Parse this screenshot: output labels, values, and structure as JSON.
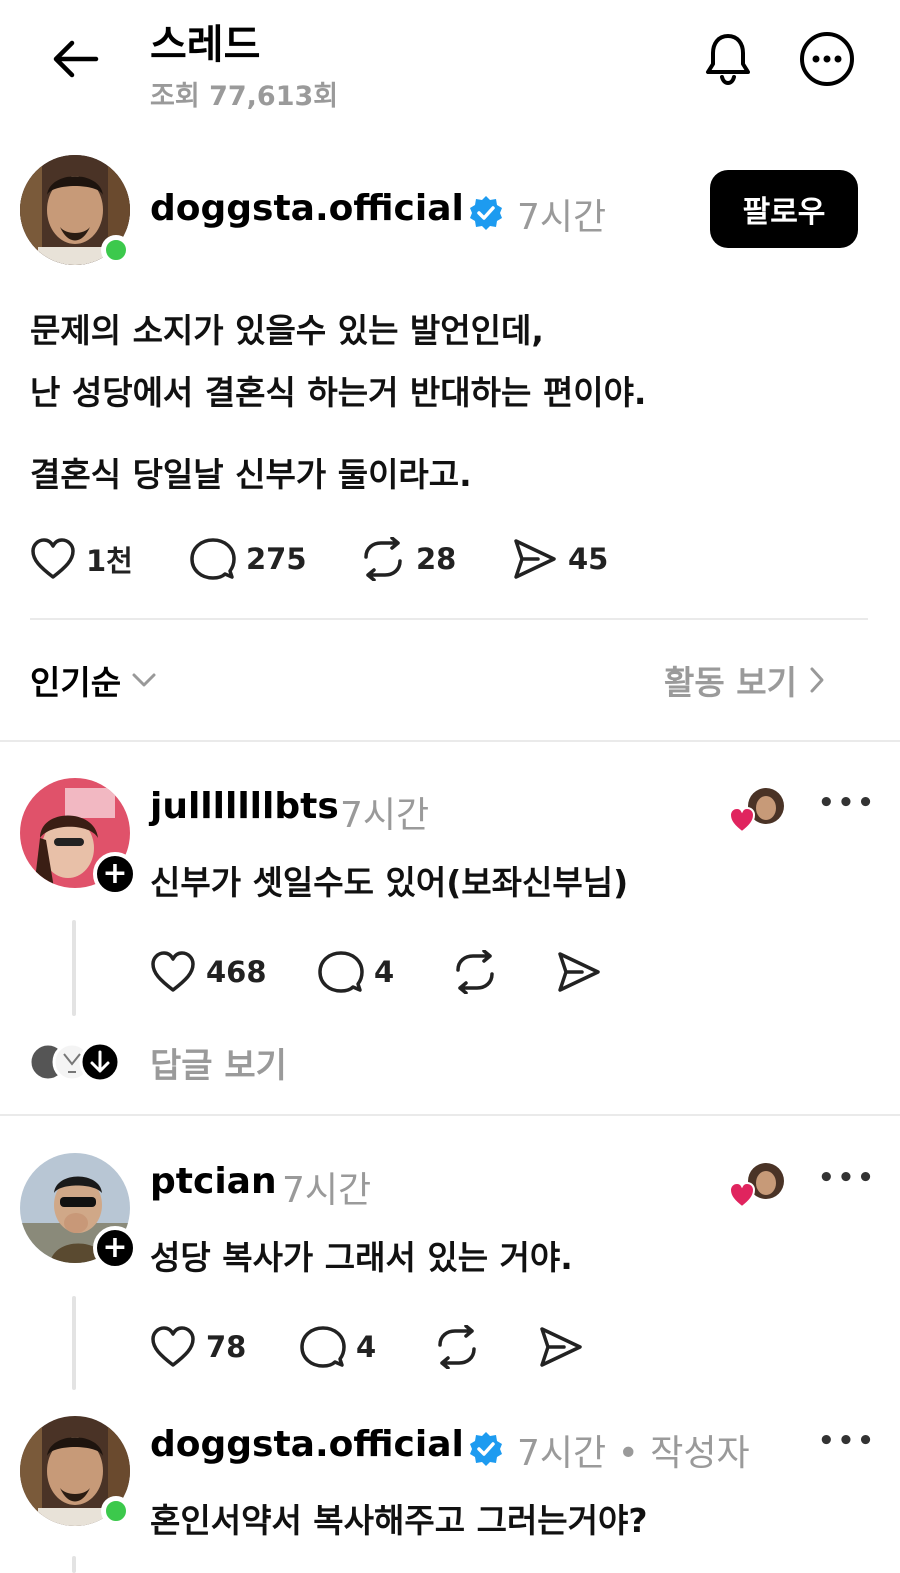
{
  "header": {
    "title": "스레드",
    "views": "조회 77,613회"
  },
  "post": {
    "username": "doggsta.official",
    "time": "7시간",
    "follow_label": "팔로우",
    "body_line1": "문제의 소지가 있을수 있는 발언인데,",
    "body_line2": "난 성당에서 결혼식 하는거 반대하는 편이야.",
    "body_line3": "결혼식 당일날 신부가 둘이라고.",
    "likes": "1천",
    "comments": "275",
    "reposts": "28",
    "shares": "45"
  },
  "sort": {
    "label": "인기순",
    "activity_label": "활동 보기"
  },
  "replies": [
    {
      "username": "julllllllbts",
      "time": "7시간",
      "text": "신부가 셋일수도 있어(보좌신부님)",
      "likes": "468",
      "comments": "4",
      "view_replies_label": "답글 보기"
    },
    {
      "username": "ptcian",
      "time": "7시간",
      "text": "성당 복사가 그래서 있는 거야.",
      "likes": "78",
      "comments": "4"
    },
    {
      "username": "doggsta.official",
      "time": "7시간 • 작성자",
      "text": "혼인서약서 복사해주고 그러는거야?"
    }
  ],
  "colors": {
    "verified": "#1d9bf0",
    "liked_heart": "#e0245e",
    "online": "#3cc94c",
    "muted_text": "#999999"
  }
}
